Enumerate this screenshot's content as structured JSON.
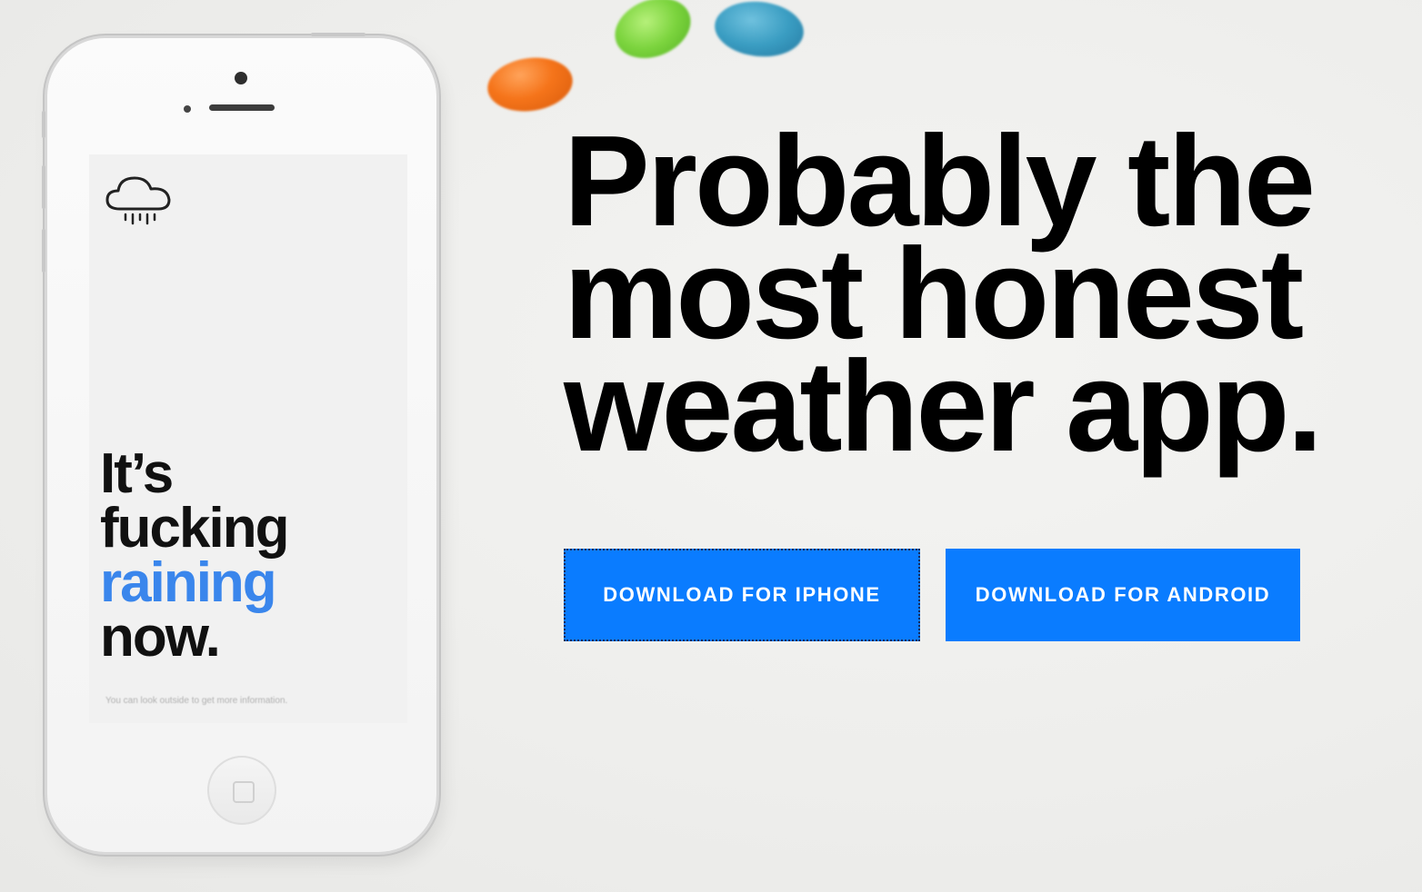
{
  "hero": {
    "title_lines": [
      "Probably the",
      "most honest",
      "weather app."
    ]
  },
  "phone": {
    "screen": {
      "icon": "rain-cloud-icon",
      "headline_lines": [
        "It’s",
        "fucking",
        "raining",
        "now."
      ],
      "highlight_color": "#3a86ec",
      "subtext": "You can look outside to get more information."
    }
  },
  "buttons": {
    "iphone_label": "DOWNLOAD FOR IPHONE",
    "android_label": "DOWNLOAD FOR ANDROID",
    "color": "#0a7cff"
  },
  "decor": {
    "jelly_beans": [
      "orange",
      "green",
      "blue"
    ]
  }
}
